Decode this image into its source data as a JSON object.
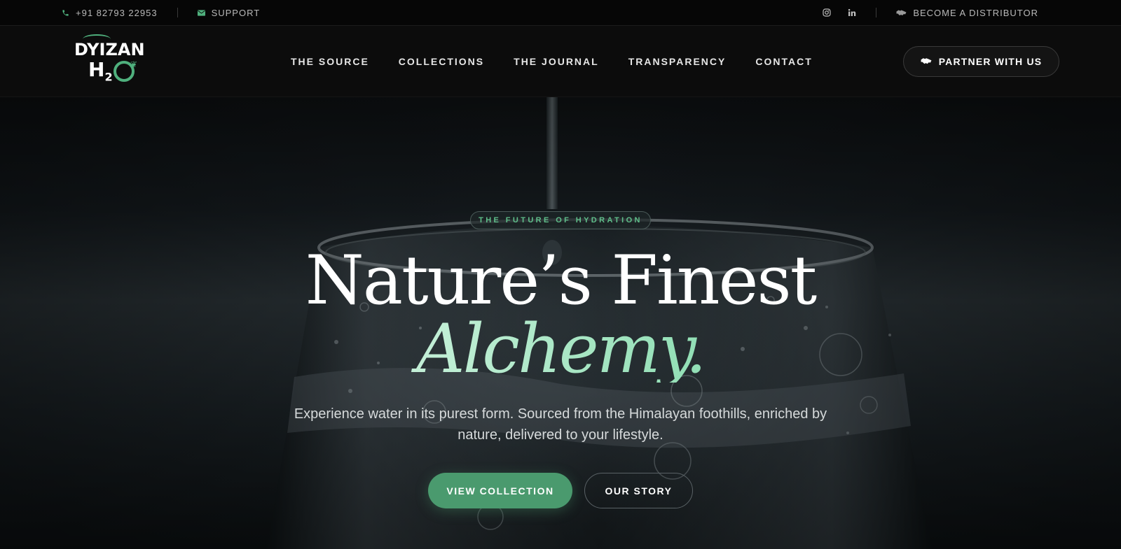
{
  "topbar": {
    "phone": "+91 82793 22953",
    "phone_icon": "phone-icon",
    "support_label": "SUPPORT",
    "support_icon": "mail-icon",
    "social_icons": [
      "instagram-icon",
      "linkedin-icon"
    ],
    "distributor_label": "BECOME A DISTRIBUTOR",
    "distributor_icon": "handshake-icon"
  },
  "logo": {
    "word": "DYIZAN",
    "h2o_h": "H",
    "h2o_sub": "2"
  },
  "nav": {
    "items": [
      {
        "label": "THE SOURCE"
      },
      {
        "label": "COLLECTIONS"
      },
      {
        "label": "THE JOURNAL"
      },
      {
        "label": "TRANSPARENCY"
      },
      {
        "label": "CONTACT"
      }
    ],
    "partner_label": "PARTNER WITH US",
    "partner_icon": "handshake-icon"
  },
  "hero": {
    "eyebrow": "THE FUTURE OF HYDRATION",
    "title_line1": "Nature’s Finest",
    "title_line2": "Alchemy.",
    "subtitle": "Experience water in its purest form. Sourced from the Himalayan foothills, enriched by nature, delivered to your lifestyle.",
    "primary_cta": "VIEW COLLECTION",
    "secondary_cta": "OUR STORY"
  },
  "colors": {
    "accent": "#4a9a6e",
    "accent_light": "#5fbf8a",
    "background": "#0b0c0d"
  }
}
